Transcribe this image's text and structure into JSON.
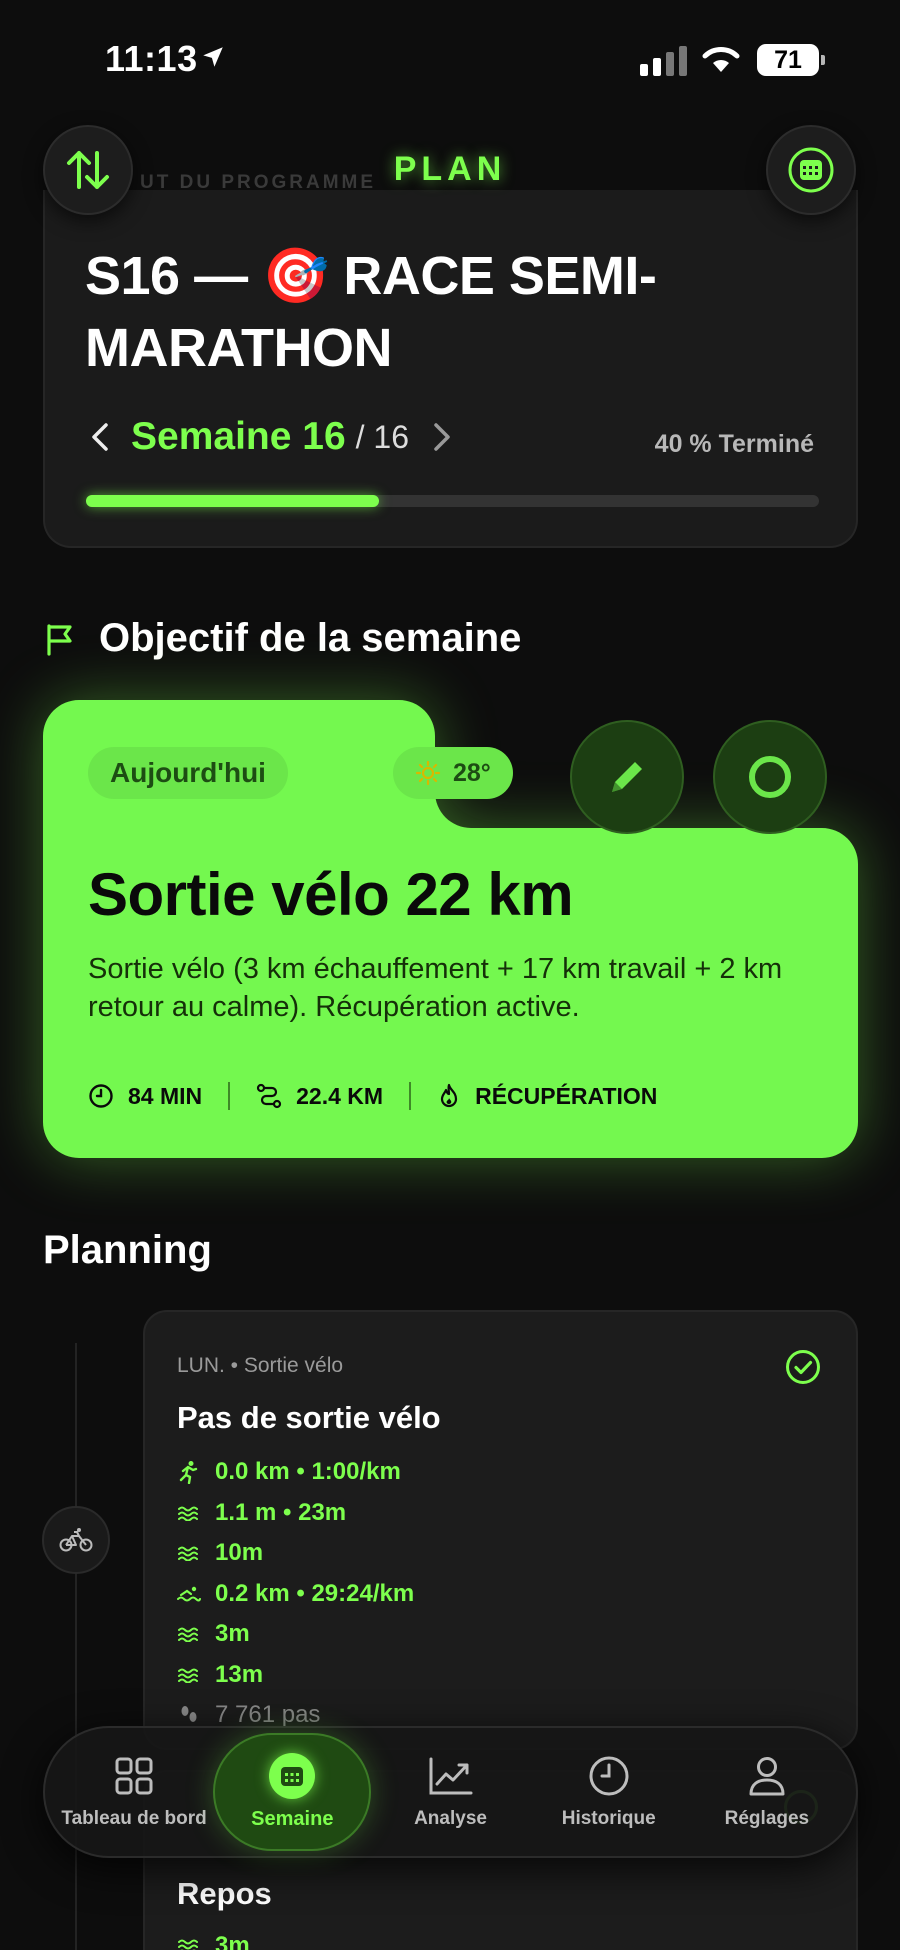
{
  "status_bar": {
    "time": "11:13",
    "battery": "71"
  },
  "header": {
    "title": "PLAN",
    "faded_text": "UT DU PROGRAMME"
  },
  "program": {
    "title": "S16 — 🎯 RACE SEMI-MARATHON",
    "week_label": "Semaine 16",
    "week_total": "/ 16",
    "completion_text": "40 % Terminé",
    "progress_fraction": 0.4
  },
  "objective": {
    "section_title": "Objectif de la semaine",
    "today_label": "Aujourd'hui",
    "weather_temp": "28°",
    "workout_title": "Sortie vélo 22 km",
    "workout_description": "Sortie vélo (3 km échauffement + 17 km travail + 2 km retour au calme). Récupération active.",
    "stats": {
      "duration": "84 MIN",
      "distance": "22.4 KM",
      "type": "RÉCUPÉRATION"
    }
  },
  "planning": {
    "title": "Planning",
    "days": [
      {
        "meta": "LUN. • Sortie vélo",
        "title": "Pas de sortie vélo",
        "metrics": [
          {
            "icon": "run-icon",
            "text": "0.0 km • 1:00/km"
          },
          {
            "icon": "waves-icon",
            "text": "1.1 m • 23m"
          },
          {
            "icon": "waves-icon",
            "text": "10m"
          },
          {
            "icon": "swim-icon",
            "text": "0.2 km • 29:24/km"
          },
          {
            "icon": "waves-icon",
            "text": "3m"
          },
          {
            "icon": "waves-icon",
            "text": "13m"
          }
        ],
        "steps": "7 761 pas"
      },
      {
        "title": "Repos",
        "metric": "3m"
      }
    ]
  },
  "tabbar": {
    "tabs": [
      {
        "label": "Tableau de bord",
        "icon": "grid-icon"
      },
      {
        "label": "Semaine",
        "icon": "calendar-icon",
        "active": true
      },
      {
        "label": "Analyse",
        "icon": "chart-icon"
      },
      {
        "label": "Historique",
        "icon": "clock-icon"
      },
      {
        "label": "Réglages",
        "icon": "person-icon"
      }
    ]
  },
  "colors": {
    "accent": "#7dff4d",
    "background": "#0d0d0d",
    "card": "#1c1c1c"
  }
}
